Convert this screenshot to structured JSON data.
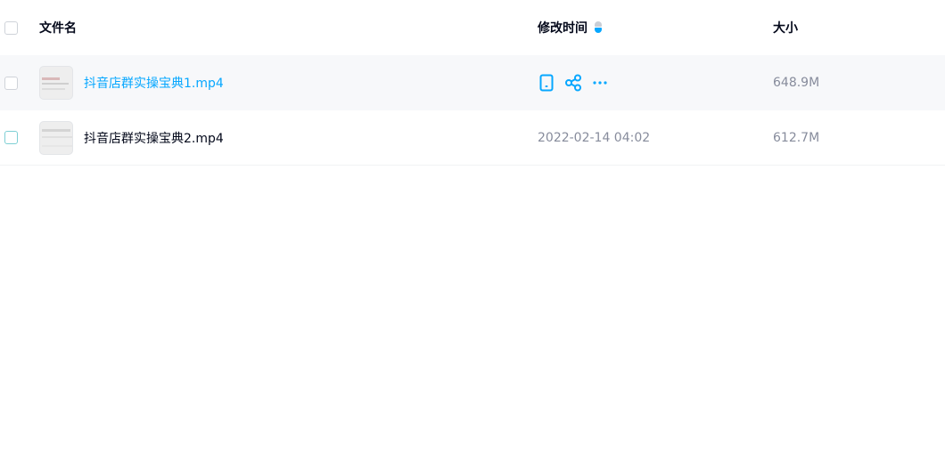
{
  "header": {
    "name_label": "文件名",
    "time_label": "修改时间",
    "size_label": "大小"
  },
  "files": [
    {
      "name": "抖音店群实操宝典1.mp4",
      "modified": "",
      "size": "648.9M"
    },
    {
      "name": "抖音店群实操宝典2.mp4",
      "modified": "2022-02-14 04:02",
      "size": "612.7M"
    }
  ],
  "icons": {
    "row_actions": [
      "phone-icon",
      "share-icon",
      "more-icon"
    ],
    "sort": "sort-icon"
  },
  "colors": {
    "accent": "#06a7ff",
    "text": "#03081a",
    "muted": "#878c9c",
    "hover_bg": "#f7f8fa"
  }
}
